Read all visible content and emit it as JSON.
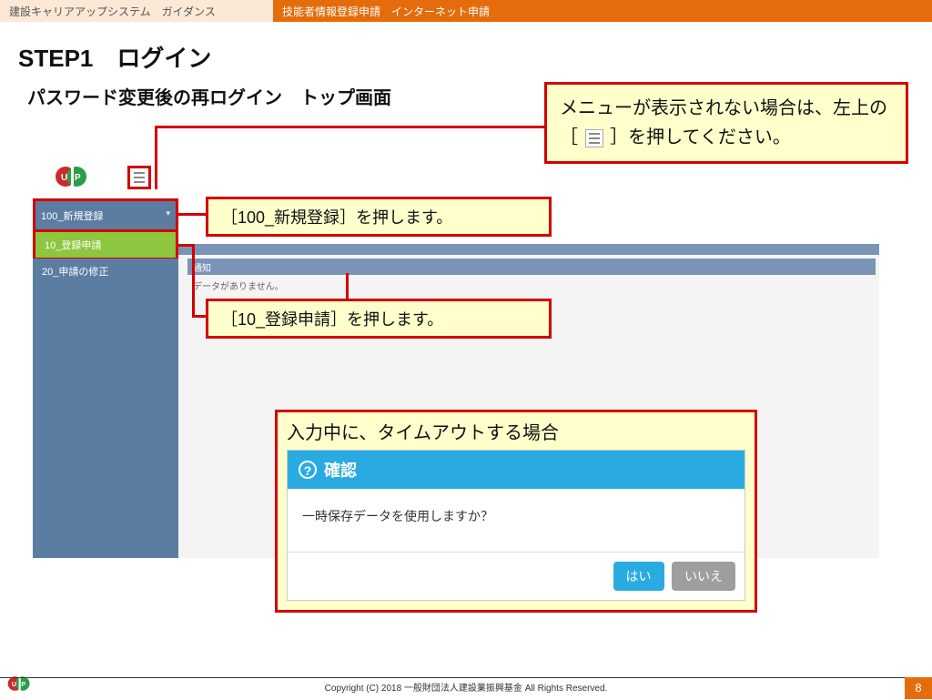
{
  "header": {
    "left": "建設キャリアアップシステム　ガイダンス",
    "right": "技能者情報登録申請　インターネット申請"
  },
  "step_title": "STEP1　ログイン",
  "subtitle": "パスワード変更後の再ログイン　トップ画面",
  "menu": {
    "item1": "100_新規登録",
    "item2": "10_登録申請",
    "item3": "20_申請の修正"
  },
  "notice": {
    "bar": "通知",
    "text": "データがありません。"
  },
  "callouts": {
    "c1": "［100_新規登録］を押します。",
    "c2": "［10_登録申請］を押します。",
    "c3_before": "メニューが表示されない場合は、左上の［",
    "c3_after": "］を押してください。"
  },
  "timeout": {
    "title": "入力中に、タイムアウトする場合",
    "modal_header": "確認",
    "modal_body": "一時保存データを使用しますか？",
    "yes": "はい",
    "no": "いいえ"
  },
  "footer": {
    "copyright": "Copyright (C) 2018 一般財団法人建設業振興基金 All Rights Reserved.",
    "page": "8"
  }
}
